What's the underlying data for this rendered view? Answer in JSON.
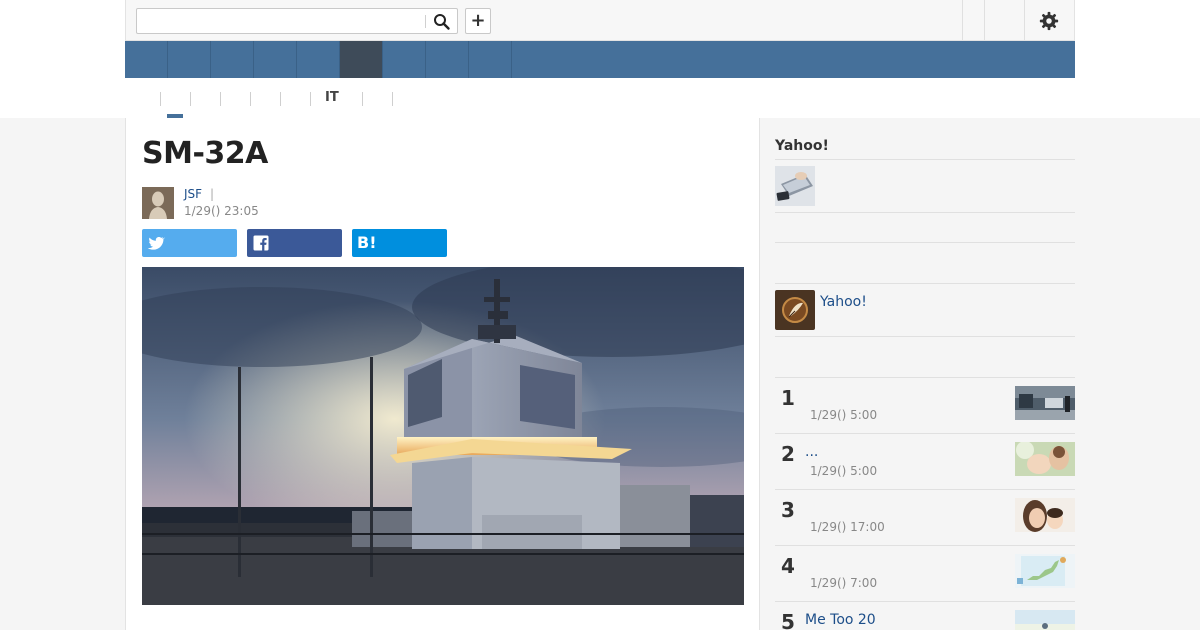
{
  "search": {
    "placeholder": "",
    "value": ""
  },
  "header": {
    "add_label": "+"
  },
  "navbar": {
    "item_count": 9,
    "active_index": 5
  },
  "subtabs": {
    "visible_label": "IT"
  },
  "article": {
    "title": "SM-32A",
    "author_name": "JSF",
    "author_separator": "|",
    "date": "1/29() 23:05",
    "share": {
      "hatena_label": "B!"
    }
  },
  "sidebar": {
    "heading": "Yahoo!",
    "promo_link": "Yahoo!",
    "ranking": [
      {
        "rank": "1",
        "title": "",
        "date": "1/29() 5:00"
      },
      {
        "rank": "2",
        "title": "...",
        "date": "1/29() 5:00"
      },
      {
        "rank": "3",
        "title": "",
        "date": "1/29() 17:00"
      },
      {
        "rank": "4",
        "title": "",
        "date": "1/29() 7:00"
      },
      {
        "rank": "5",
        "title": "Me Too 20",
        "date": ""
      }
    ]
  },
  "colors": {
    "navbar": "#45709a",
    "navbar_active": "#3e4b59",
    "twitter": "#55acee",
    "facebook": "#3b5998",
    "hatena": "#008fde",
    "link": "#1d4e89"
  }
}
